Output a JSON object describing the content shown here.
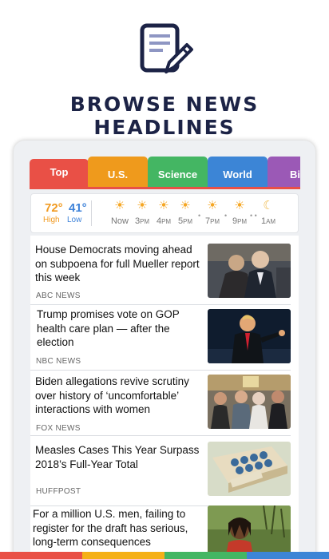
{
  "promo": {
    "title": "BROWSE NEWS HEADLINES",
    "icon": "edit-document-icon"
  },
  "tabs": [
    {
      "label": "Top",
      "color": "#e95046"
    },
    {
      "label": "U.S.",
      "color": "#ef9a1c"
    },
    {
      "label": "Science",
      "color": "#44b663"
    },
    {
      "label": "World",
      "color": "#3c85d6"
    },
    {
      "label": "Biz",
      "color": "#9b59b6"
    }
  ],
  "weather": {
    "high": "72°",
    "low": "41°",
    "high_label": "High",
    "low_label": "Low",
    "forecast": [
      {
        "icon": "sun-icon",
        "time": "Now",
        "suffix": ""
      },
      {
        "icon": "sun-icon",
        "time": "3",
        "suffix": "PM"
      },
      {
        "icon": "sun-icon",
        "time": "4",
        "suffix": "PM"
      },
      {
        "icon": "sun-icon",
        "time": "5",
        "suffix": "PM"
      },
      {
        "icon": "sun-icon",
        "time": "7",
        "suffix": "PM"
      },
      {
        "icon": "sun-icon",
        "time": "9",
        "suffix": "PM"
      },
      {
        "icon": "moon-icon",
        "time": "1",
        "suffix": "AM"
      }
    ]
  },
  "stories": [
    {
      "headline": "House Democrats moving ahead on subpoena for full Mueller report this week",
      "source": "ABC NEWS",
      "image": "mueller-photo"
    },
    {
      "headline": "Trump promises vote on GOP health care plan — after the election",
      "source": "NBC NEWS",
      "image": "trump-photo"
    },
    {
      "headline": "Biden allegations revive scrutiny over history of ‘uncomfortable’ interactions with women",
      "source": "FOX NEWS",
      "image": "biden-photo"
    },
    {
      "headline": "Measles Cases This Year Surpass 2018’s Full-Year Total",
      "source": "HUFFPOST",
      "image": "vaccine-vials-photo"
    },
    {
      "headline": "For a million U.S. men, failing to register for the draft has serious, long-term consequences",
      "source": "",
      "image": "man-outdoors-photo"
    }
  ],
  "footer_colors": [
    "#e95046",
    "#f5b018",
    "#44b663",
    "#3c85d6"
  ]
}
